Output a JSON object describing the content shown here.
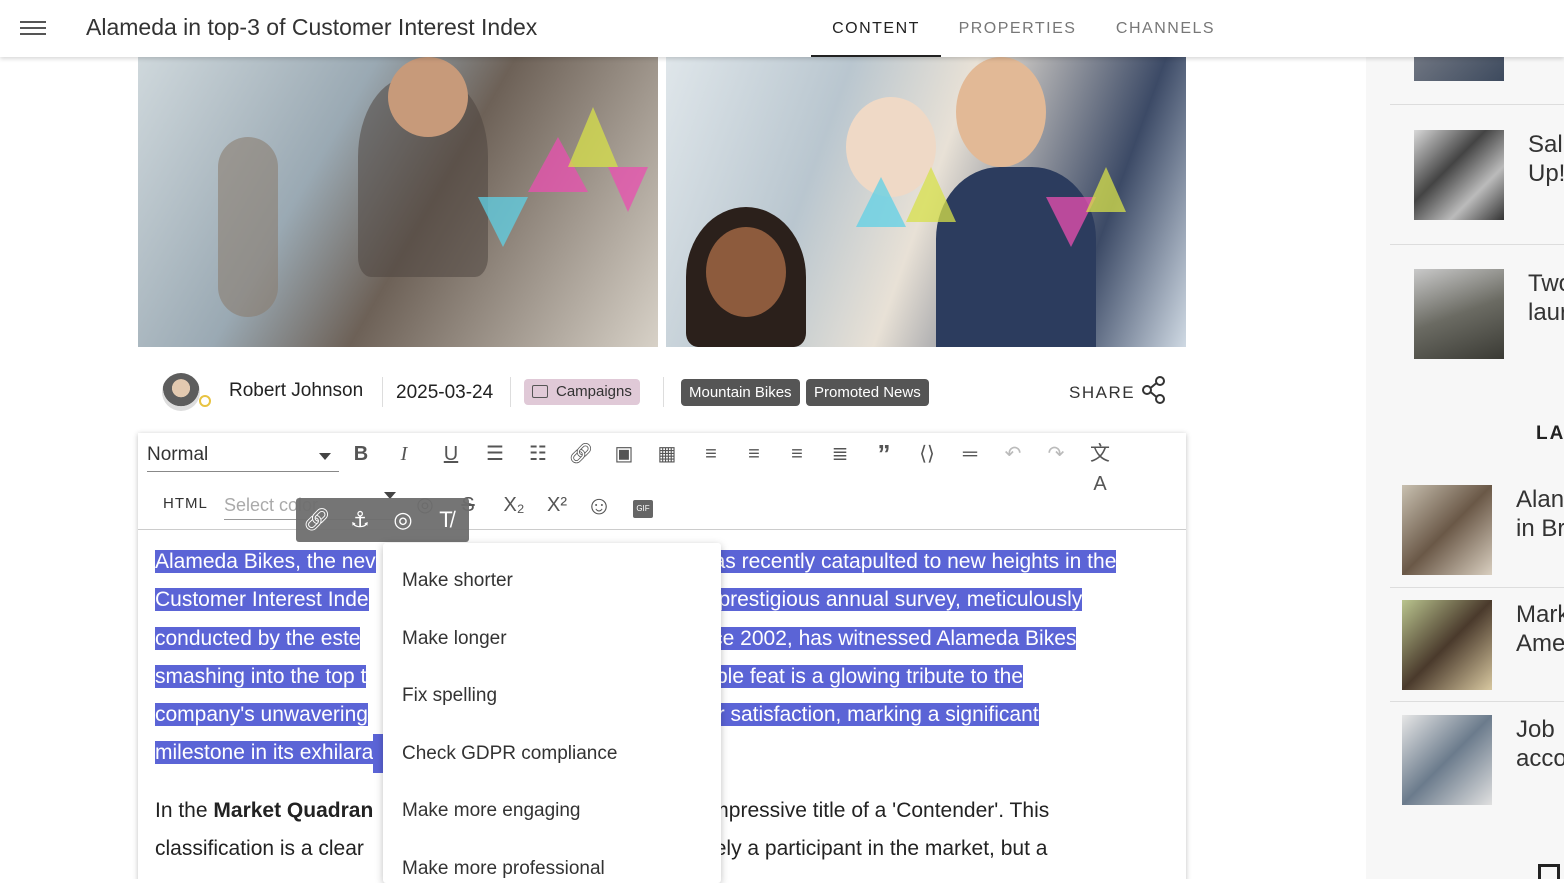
{
  "header": {
    "menu_icon": "hamburger-menu-icon",
    "title": "Alameda in top-3 of Customer Interest Index",
    "tabs": [
      {
        "label": "CONTENT",
        "active": true
      },
      {
        "label": "PROPERTIES",
        "active": false
      },
      {
        "label": "CHANNELS",
        "active": false
      }
    ]
  },
  "article": {
    "author": "Robert Johnson",
    "date": "2025-03-24",
    "category": "Campaigns",
    "tags": [
      "Mountain Bikes",
      "Promoted News"
    ],
    "share_label": "SHARE"
  },
  "editor": {
    "format_select": "Normal",
    "html_label": "HTML",
    "color_placeholder": "Select color",
    "toolbar_row1_icons": [
      "bold-icon",
      "italic-icon",
      "underline-icon",
      "bullet-list-icon",
      "numbered-list-icon",
      "link-icon",
      "image-icon",
      "table-icon",
      "align-left-icon",
      "align-center-icon",
      "align-right-icon",
      "align-justify-icon",
      "quote-icon",
      "code-block-icon",
      "horizontal-rule-icon",
      "undo-icon",
      "redo-icon",
      "translate-icon"
    ],
    "toolbar_row2_icons": [
      "ai-assistant-icon",
      "strikethrough-icon",
      "subscript-icon",
      "superscript-icon",
      "emoji-icon",
      "gif-icon"
    ],
    "floating_toolbar_icons": [
      "link-icon",
      "anchor-icon",
      "ai-assistant-icon",
      "clear-format-icon"
    ],
    "selected_paragraph_lines": [
      {
        "left": "Alameda Bikes, the nev",
        "right": "as recently catapulted to new heights in the"
      },
      {
        "left": "Customer Interest Inde",
        "right": " prestigious annual survey, meticulously"
      },
      {
        "left": "conducted by the este",
        "right": "nce 2002, has witnessed Alameda Bikes"
      },
      {
        "left": "smashing into the top t",
        "right": "able feat is a glowing tribute to the"
      },
      {
        "left": "company's unwavering",
        "right": "er satisfaction, marking a significant"
      },
      {
        "left": "milestone in its exhilara",
        "right": ""
      }
    ],
    "paragraph2": {
      "line1_prefix": "In the ",
      "line1_bold": "Market Quadran",
      "line1_right": "mpressive title of a 'Contender'. This",
      "line2_left": "classification is a clear ",
      "line2_right": "rely a participant in the market, but a"
    }
  },
  "ai_menu": {
    "items": [
      "Make shorter",
      "Make longer",
      "Fix spelling",
      "Check GDPR compliance",
      "Make more engaging",
      "Make more professional"
    ]
  },
  "sidebar": {
    "top_items": [
      {
        "line1": "Sal",
        "line2": "Up!"
      },
      {
        "line1": "Two",
        "line2": "laur"
      }
    ],
    "heading": "LA",
    "latest_items": [
      {
        "line1": "Alan",
        "line2": "in Br"
      },
      {
        "line1": "Mark",
        "line2": "Ame"
      },
      {
        "line1": "Job",
        "line2": "acco"
      }
    ]
  }
}
